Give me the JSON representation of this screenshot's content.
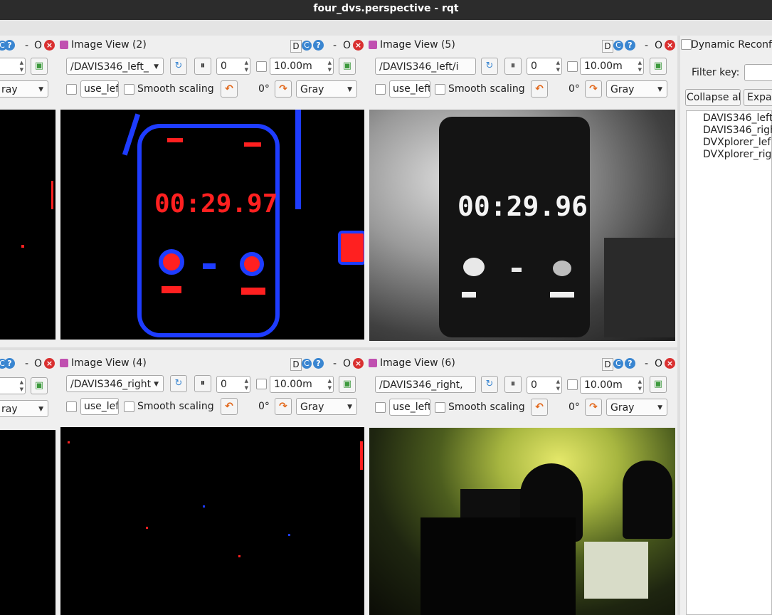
{
  "window": {
    "title": "four_dvs.perspective - rqt"
  },
  "views": {
    "left_top": {
      "combo_value": "ray",
      "spin_value": ""
    },
    "left_bottom": {
      "combo_value": "ray"
    },
    "v2": {
      "title": "Image View (2)",
      "topic": "/DAVIS346_left_",
      "frame": "0",
      "timeout": "10.00m",
      "use_topic": "use_left",
      "smooth": "Smooth scaling",
      "rotation": "0°",
      "color": "Gray",
      "overlay": "00:29.97"
    },
    "v5": {
      "title": "Image View (5)",
      "topic": "/DAVIS346_left/i",
      "frame": "0",
      "timeout": "10.00m",
      "use_topic": "use_left",
      "smooth": "Smooth scaling",
      "rotation": "0°",
      "color": "Gray",
      "overlay": "00:29.96"
    },
    "v4": {
      "title": "Image View (4)",
      "topic": "/DAVIS346_right",
      "frame": "0",
      "timeout": "10.00m",
      "use_topic": "use_left",
      "smooth": "Smooth scaling",
      "rotation": "0°",
      "color": "Gray"
    },
    "v6": {
      "title": "Image View (6)",
      "topic": "/DAVIS346_right,",
      "frame": "0",
      "timeout": "10.00m",
      "use_topic": "use_left",
      "smooth": "Smooth scaling",
      "rotation": "0°",
      "color": "Gray"
    }
  },
  "header_glyphs": {
    "d": "D",
    "dash": "-",
    "o": "O",
    "x": "×",
    "q": "?",
    "r": "C"
  },
  "dynreconf": {
    "title": "Dynamic Reconfi",
    "filter_label": "Filter key:",
    "filter_value": "",
    "collapse": "Collapse all",
    "expand": "Expar",
    "nodes": [
      "DAVIS346_left",
      "DAVIS346_righ",
      "DVXplorer_lef",
      "DVXplorer_rig"
    ]
  },
  "colors": {
    "titlebar": "#2c2c2c",
    "event_pos": "#1e3cff",
    "event_neg": "#ff2020",
    "help_icon": "#3a86d1",
    "close_icon": "#d93030",
    "rotate_icon": "#e2681c"
  }
}
